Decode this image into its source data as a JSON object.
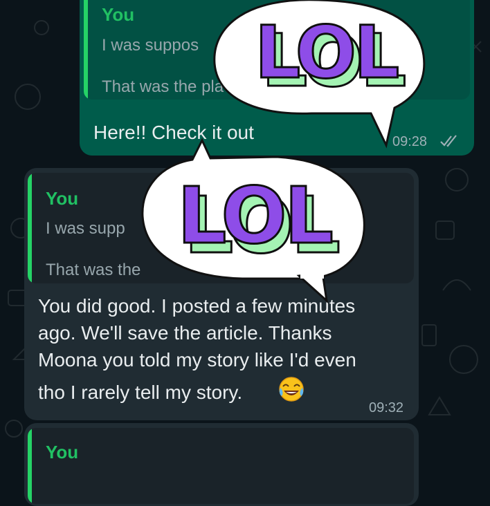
{
  "messages": [
    {
      "quote": {
        "author": "You",
        "line1": "I was suppos",
        "line2": "That was the pla"
      },
      "text": "Here!! Check it out",
      "time": "09:28",
      "status_icon": "double-check-icon"
    },
    {
      "quote": {
        "author": "You",
        "line1": "I was supp",
        "line2": "That was the"
      },
      "text_lines": [
        "You did good. I posted a few minutes",
        "ago. We'll save the article. Thanks",
        "Moona you told my story like I'd even",
        "tho I rarely tell my story."
      ],
      "emoji": "tears-of-joy-emoji",
      "time": "09:32"
    },
    {
      "quote": {
        "author": "You"
      }
    }
  ],
  "stickers": [
    {
      "text": "LOL",
      "icon": "speech-bubble-sticker"
    },
    {
      "text": "LOL",
      "icon": "speech-bubble-sticker"
    }
  ],
  "colors": {
    "background": "#0b141a",
    "outgoing_bubble": "#005c4b",
    "incoming_bubble": "#202c33",
    "quote_accent": "#25d366",
    "sticker_letters": "#8e4de8",
    "sticker_shadow": "#a4f3b3"
  }
}
